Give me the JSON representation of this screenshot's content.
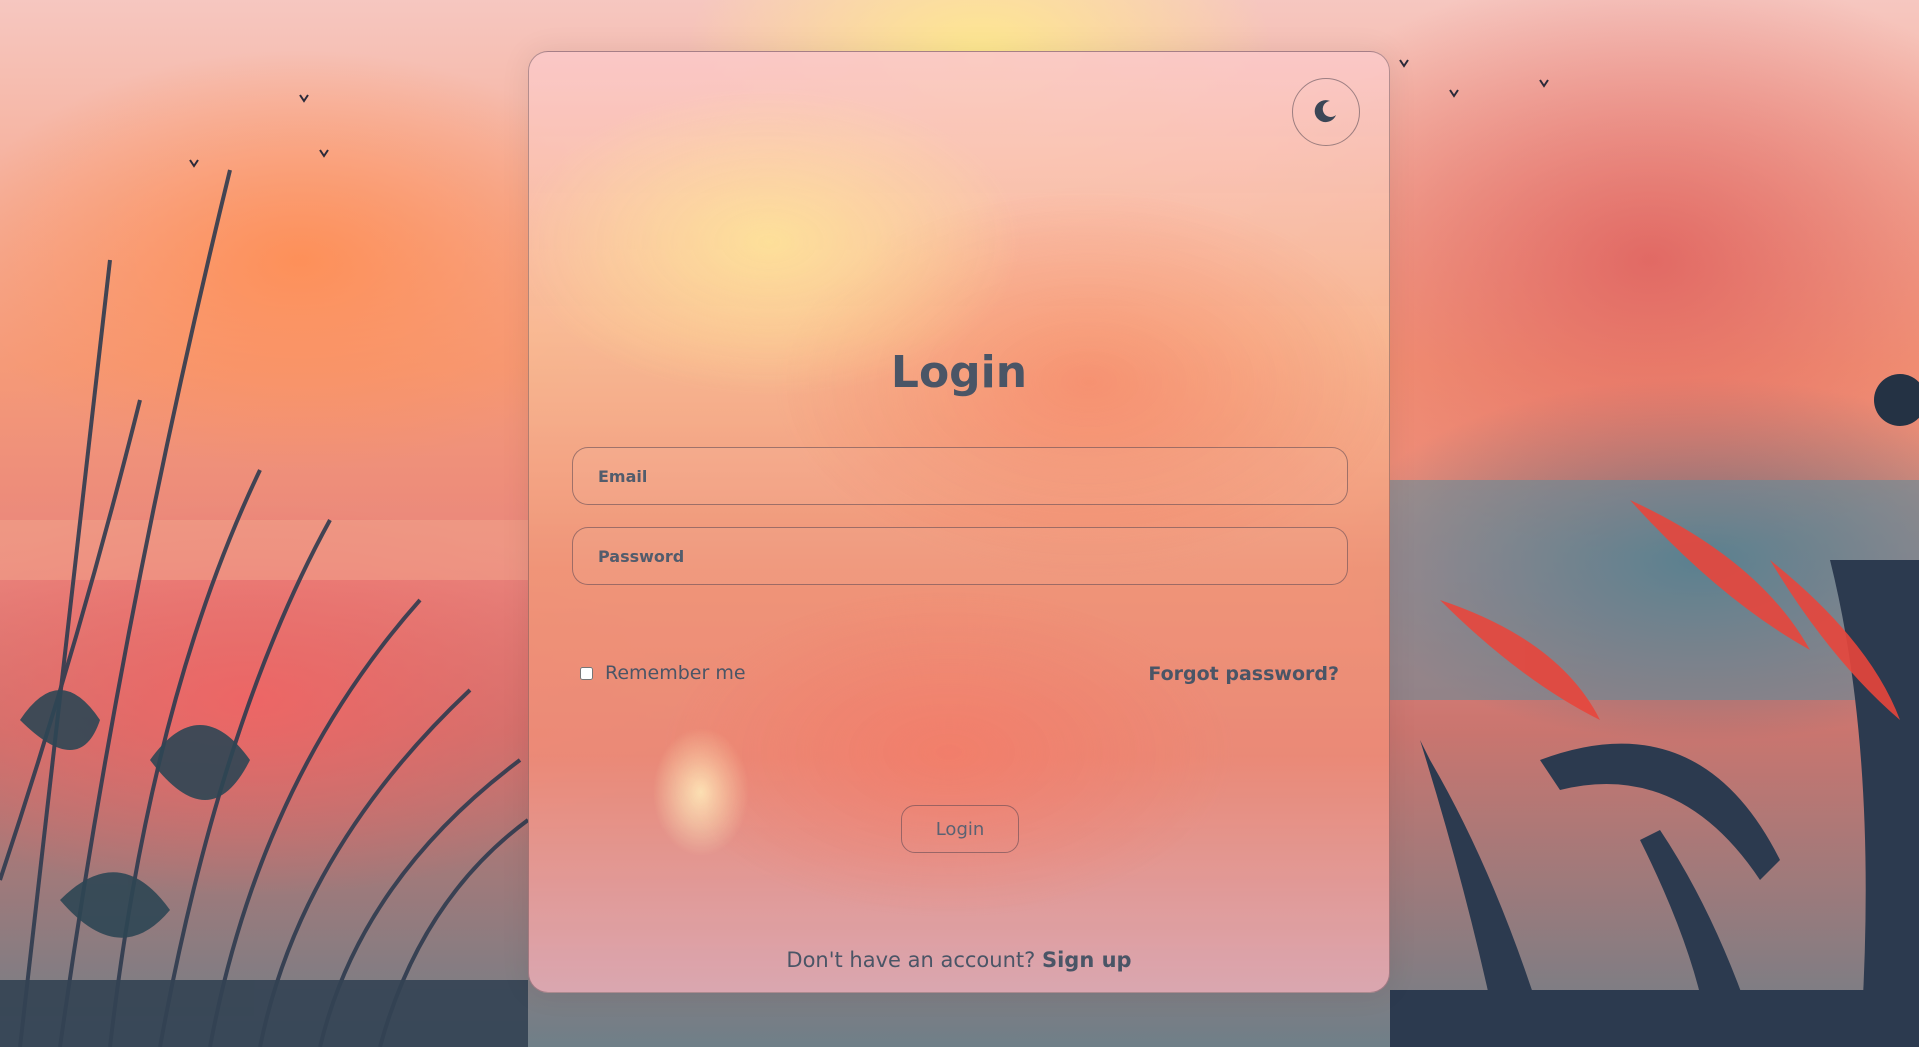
{
  "theme_toggle": {
    "icon": "moon-icon"
  },
  "login_form": {
    "title": "Login",
    "email": {
      "placeholder": "Email",
      "value": ""
    },
    "password": {
      "placeholder": "Password",
      "value": ""
    },
    "remember_me": {
      "label": "Remember me",
      "checked": false
    },
    "forgot_password_label": "Forgot password?",
    "submit_label": "Login",
    "signup_prompt": "Don't have an account?",
    "signup_link": "Sign up"
  },
  "colors": {
    "text": "#4a5566",
    "card_border": "#5a4650"
  }
}
